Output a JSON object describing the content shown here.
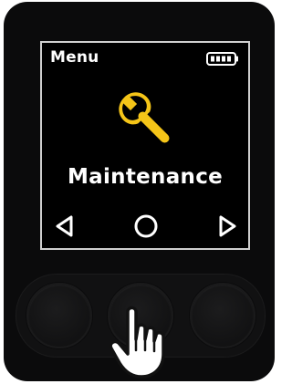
{
  "screen": {
    "title": "Menu",
    "item_label": "Maintenance",
    "item_icon": "wrench-icon",
    "accent_color": "#f5c518",
    "battery_icon": "battery-full-icon"
  },
  "navigation": {
    "left": "triangle-left-icon",
    "select": "circle-icon",
    "right": "triangle-right-icon"
  },
  "hardware_buttons": [
    {
      "name": "left-hardware-button"
    },
    {
      "name": "center-hardware-button",
      "pressed": true
    },
    {
      "name": "right-hardware-button"
    }
  ],
  "cursor": "pointing-hand-icon"
}
